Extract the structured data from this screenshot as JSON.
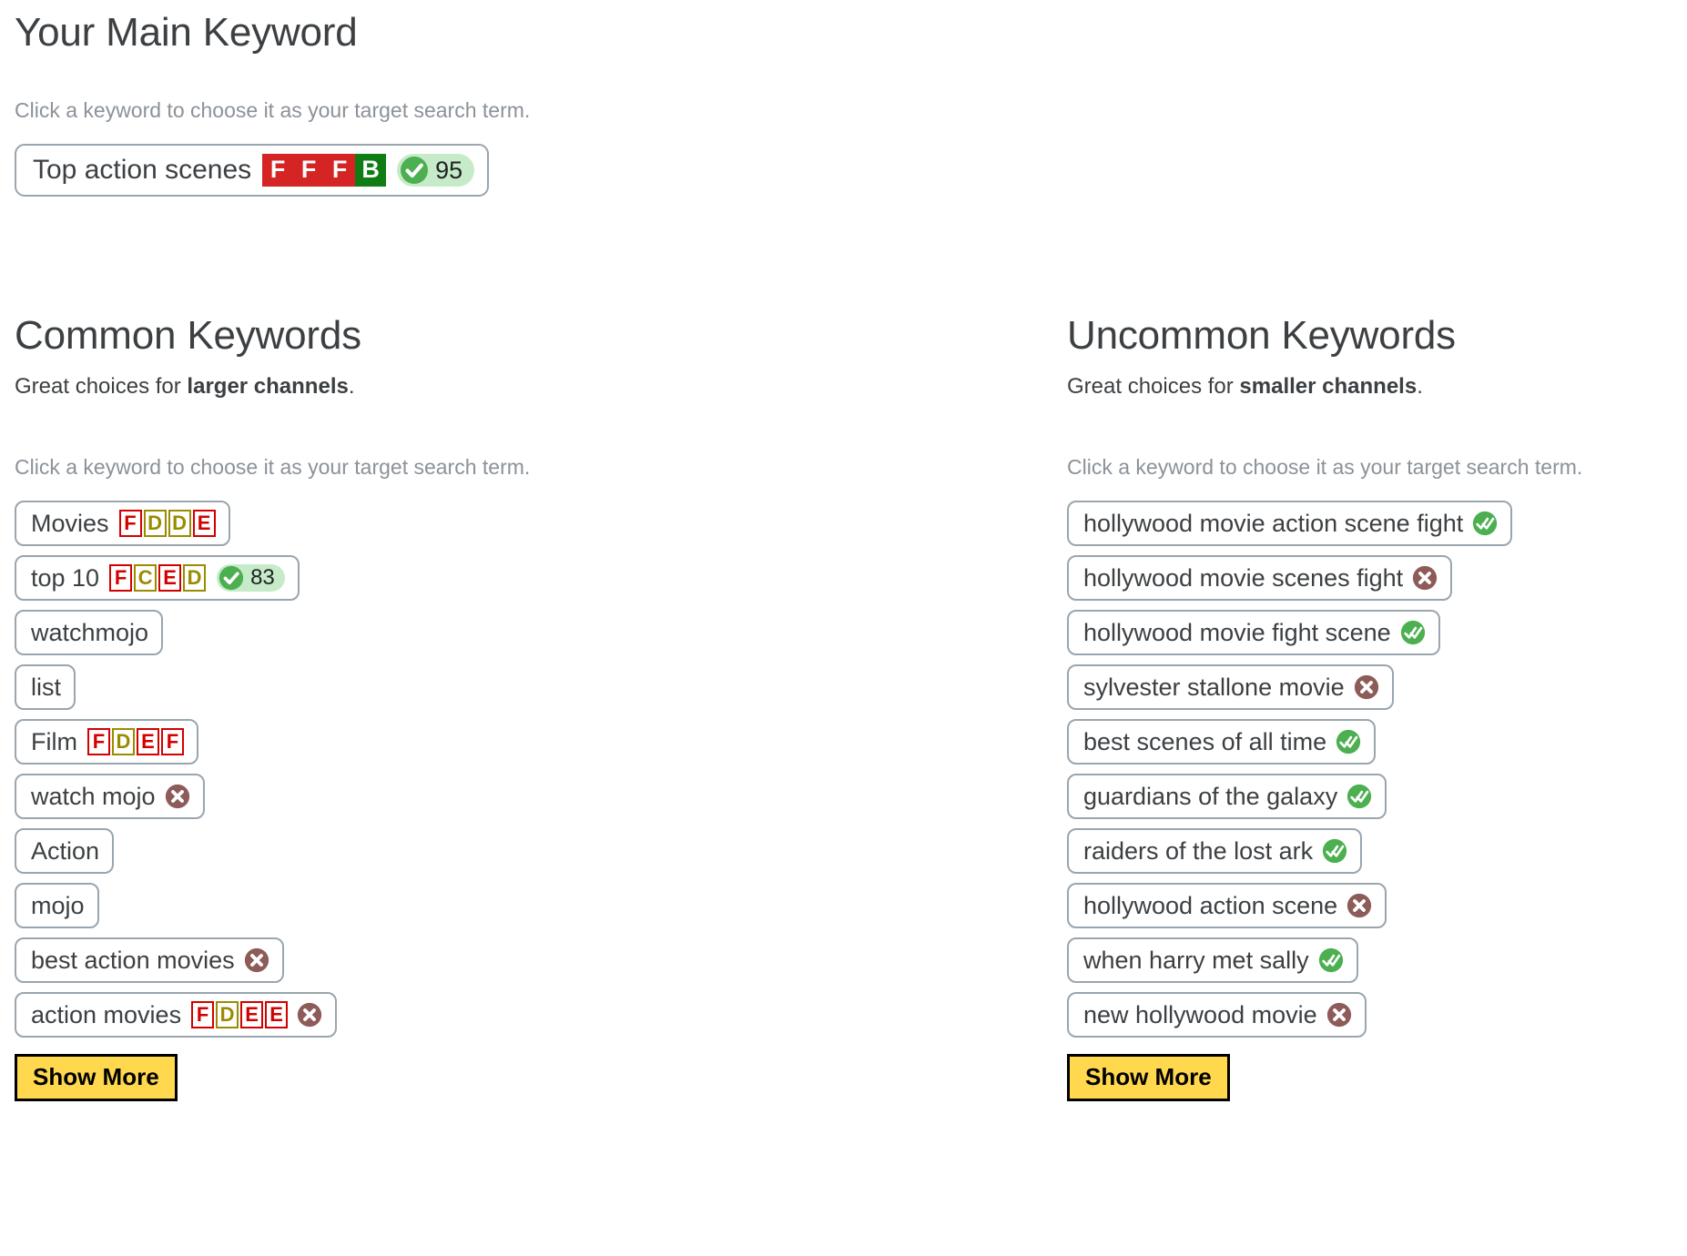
{
  "main_section": {
    "title": "Your Main Keyword",
    "hint": "Click a keyword to choose it as your target search term.",
    "keyword": {
      "label": "Top action scenes",
      "grades": [
        {
          "letter": "F",
          "color": "red"
        },
        {
          "letter": "F",
          "color": "red"
        },
        {
          "letter": "F",
          "color": "red"
        },
        {
          "letter": "B",
          "color": "green"
        }
      ],
      "score": "95",
      "score_icon": "check-circle-icon"
    }
  },
  "common_section": {
    "title": "Common Keywords",
    "subtitle_prefix": "Great choices for ",
    "subtitle_bold": "larger channels",
    "subtitle_suffix": ".",
    "hint": "Click a keyword to choose it as your target search term.",
    "show_more_label": "Show More",
    "keywords": [
      {
        "label": "Movies",
        "grades": [
          {
            "letter": "F",
            "color": "red"
          },
          {
            "letter": "D",
            "color": "olive"
          },
          {
            "letter": "D",
            "color": "olive"
          },
          {
            "letter": "E",
            "color": "red"
          }
        ],
        "score": null,
        "status": null
      },
      {
        "label": "top 10",
        "grades": [
          {
            "letter": "F",
            "color": "red"
          },
          {
            "letter": "C",
            "color": "olive"
          },
          {
            "letter": "E",
            "color": "red"
          },
          {
            "letter": "D",
            "color": "olive"
          }
        ],
        "score": "83",
        "status": null
      },
      {
        "label": "watchmojo",
        "grades": [],
        "score": null,
        "status": null
      },
      {
        "label": "list",
        "grades": [],
        "score": null,
        "status": null
      },
      {
        "label": "Film",
        "grades": [
          {
            "letter": "F",
            "color": "red"
          },
          {
            "letter": "D",
            "color": "olive"
          },
          {
            "letter": "E",
            "color": "red"
          },
          {
            "letter": "F",
            "color": "red"
          }
        ],
        "score": null,
        "status": null
      },
      {
        "label": "watch mojo",
        "grades": [],
        "score": null,
        "status": "x-circle-icon"
      },
      {
        "label": "Action",
        "grades": [],
        "score": null,
        "status": null
      },
      {
        "label": "mojo",
        "grades": [],
        "score": null,
        "status": null
      },
      {
        "label": "best action movies",
        "grades": [],
        "score": null,
        "status": "x-circle-icon"
      },
      {
        "label": "action movies",
        "grades": [
          {
            "letter": "F",
            "color": "red"
          },
          {
            "letter": "D",
            "color": "olive"
          },
          {
            "letter": "E",
            "color": "red"
          },
          {
            "letter": "E",
            "color": "red"
          }
        ],
        "score": null,
        "status": "x-circle-icon"
      }
    ]
  },
  "uncommon_section": {
    "title": "Uncommon Keywords",
    "subtitle_prefix": "Great choices for ",
    "subtitle_bold": "smaller channels",
    "subtitle_suffix": ".",
    "hint": "Click a keyword to choose it as your target search term.",
    "show_more_label": "Show More",
    "keywords": [
      {
        "label": "hollywood movie action scene fight",
        "grades": [],
        "score": null,
        "status": "double-check-circle-icon"
      },
      {
        "label": "hollywood movie scenes fight",
        "grades": [],
        "score": null,
        "status": "x-circle-icon"
      },
      {
        "label": "hollywood movie fight scene",
        "grades": [],
        "score": null,
        "status": "double-check-circle-icon"
      },
      {
        "label": "sylvester stallone movie",
        "grades": [],
        "score": null,
        "status": "x-circle-icon"
      },
      {
        "label": "best scenes of all time",
        "grades": [],
        "score": null,
        "status": "double-check-circle-icon"
      },
      {
        "label": "guardians of the galaxy",
        "grades": [],
        "score": null,
        "status": "double-check-circle-icon"
      },
      {
        "label": "raiders of the lost ark",
        "grades": [],
        "score": null,
        "status": "double-check-circle-icon"
      },
      {
        "label": "hollywood action scene",
        "grades": [],
        "score": null,
        "status": "x-circle-icon"
      },
      {
        "label": "when harry met sally",
        "grades": [],
        "score": null,
        "status": "double-check-circle-icon"
      },
      {
        "label": "new hollywood movie",
        "grades": [],
        "score": null,
        "status": "x-circle-icon"
      }
    ]
  },
  "colors": {
    "grade_red": "#d40000",
    "grade_olive": "#9a8c00",
    "grade_green": "#0b7a0b",
    "main_grade_red_bg": "#d42424",
    "main_grade_green_bg": "#0f7d14",
    "score_pill_bg": "#c6ebc9",
    "check_green": "#4caf50",
    "x_maroon": "#8d5b58",
    "show_more_bg": "#ffd84d",
    "chip_border": "#9aa5ae",
    "hint_text": "#8b9299",
    "body_text": "#3c4043"
  }
}
